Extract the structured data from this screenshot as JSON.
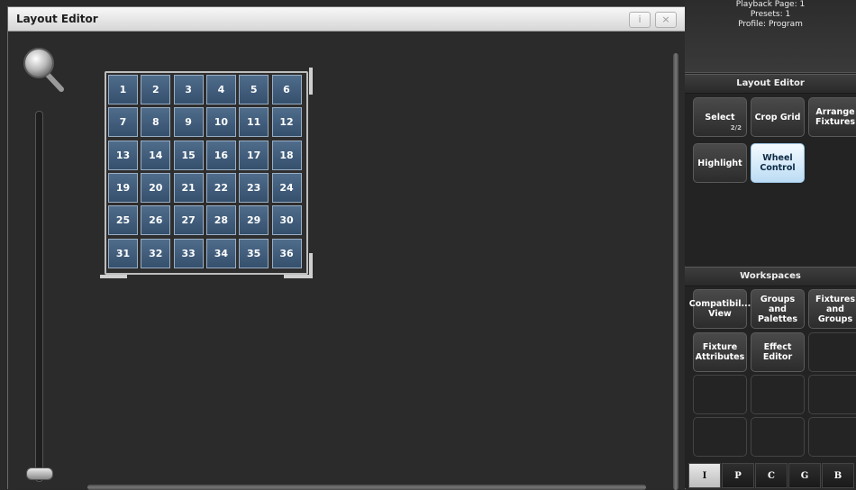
{
  "window": {
    "title": "Layout Editor",
    "info_label": "i",
    "close_label": "×"
  },
  "grid": {
    "cells": [
      "1",
      "2",
      "3",
      "4",
      "5",
      "6",
      "7",
      "8",
      "9",
      "10",
      "11",
      "12",
      "13",
      "14",
      "15",
      "16",
      "17",
      "18",
      "19",
      "20",
      "21",
      "22",
      "23",
      "24",
      "25",
      "26",
      "27",
      "28",
      "29",
      "30",
      "31",
      "32",
      "33",
      "34",
      "35",
      "36"
    ]
  },
  "status": {
    "line1": "Playback Page: 1",
    "line2": "Presets: 1",
    "line3": "Profile: Program"
  },
  "layout_editor": {
    "header": "Layout Editor",
    "select_label": "Select",
    "select_sub": "2/2",
    "crop_grid_label": "Crop Grid",
    "arrange_label": "Arrange Fixtures",
    "highlight_label": "Highlight",
    "wheel_label": "Wheel Control"
  },
  "workspaces": {
    "header": "Workspaces",
    "compat_label": "Compatibil... View",
    "groups_palettes_label": "Groups and Palettes",
    "fixtures_groups_label": "Fixtures and Groups",
    "fixture_attr_label": "Fixture Attributes",
    "effect_editor_label": "Effect Editor"
  },
  "tabs": [
    "I",
    "P",
    "C",
    "G",
    "B"
  ],
  "colors": {
    "cell_fill": "#44607f",
    "active_button": "#cfe6fa",
    "background": "#2b2b2b"
  }
}
